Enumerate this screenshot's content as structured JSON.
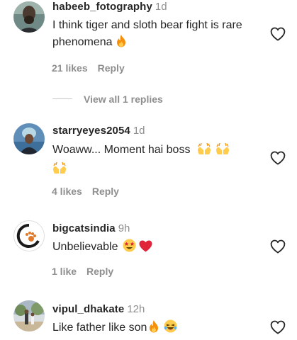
{
  "comments": [
    {
      "username": "habeeb_fotography",
      "time": "1d",
      "text": "I think tiger and sloth bear fight is rare phenomena",
      "likes": "21 likes",
      "reply": "Reply",
      "view_replies": "View all 1 replies",
      "emojis": [
        "fire-emoji"
      ]
    },
    {
      "username": "starryeyes2054",
      "time": "1d",
      "text": "Woaww... Moment hai boss",
      "likes": "4 likes",
      "reply": "Reply",
      "emojis": [
        "raising-hands-emoji",
        "raising-hands-emoji",
        "raising-hands-emoji"
      ]
    },
    {
      "username": "bigcatsindia",
      "time": "9h",
      "text": "Unbelievable",
      "likes": "1 like",
      "reply": "Reply",
      "emojis": [
        "star-struck-emoji",
        "red-heart-emoji"
      ]
    },
    {
      "username": "vipul_dhakate",
      "time": "12h",
      "text": "Like father like son",
      "emojis": [
        "fire-emoji",
        "laughing-emoji"
      ]
    }
  ],
  "icons": {
    "like": "heart-outline-icon"
  },
  "colors": {
    "text": "#262626",
    "secondary": "#8e8e8e",
    "divider": "#c7c7c7",
    "fire": "#f4900c",
    "heart": "#e0243a"
  }
}
